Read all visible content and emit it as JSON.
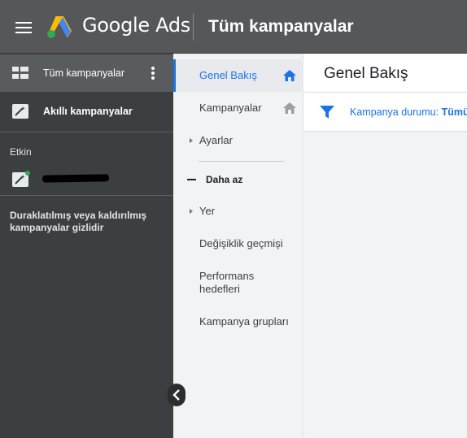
{
  "header": {
    "brand": "Google Ads",
    "title": "Tüm kampanyalar"
  },
  "leftnav": {
    "all_campaigns": "Tüm kampanyalar",
    "smart_campaigns": "Akıllı kampanyalar",
    "section_active": "Etkin",
    "hidden_note": "Duraklatılmış veya kaldırılmış kampanyalar gizlidir"
  },
  "subnav": {
    "overview": "Genel Bakış",
    "campaigns": "Kampanyalar",
    "settings": "Ayarlar",
    "less": "Daha az",
    "locations": "Yer",
    "change_history": "Değişiklik geçmişi",
    "performance_goals": "Performans hedefleri",
    "campaign_groups": "Kampanya grupları"
  },
  "main": {
    "heading": "Genel Bakış",
    "filter_label": "Kampanya durumu:",
    "filter_value": "Tümü"
  },
  "colors": {
    "topbar": "#555759",
    "leftnav": "#3c3f41",
    "accent": "#1a73e8"
  }
}
